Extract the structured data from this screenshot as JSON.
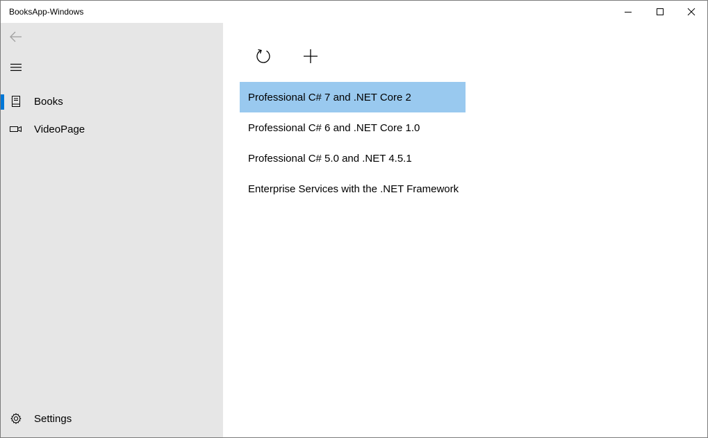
{
  "window": {
    "title": "BooksApp-Windows",
    "controls": {
      "minimize": "minimize-icon",
      "maximize": "maximize-icon",
      "close": "close-icon"
    }
  },
  "nav": {
    "back_icon": "back-arrow-icon",
    "menu_icon": "hamburger-icon",
    "items": [
      {
        "label": "Books",
        "icon": "book-icon",
        "selected": true
      },
      {
        "label": "VideoPage",
        "icon": "video-icon",
        "selected": false
      }
    ],
    "settings": {
      "label": "Settings",
      "icon": "gear-icon"
    },
    "accent_color": "#0078d7"
  },
  "commands": {
    "refresh_icon": "refresh-icon",
    "add_icon": "add-icon"
  },
  "books": [
    {
      "title": "Professional C# 7 and .NET Core 2",
      "selected": true
    },
    {
      "title": "Professional C# 6 and .NET Core 1.0",
      "selected": false
    },
    {
      "title": "Professional C# 5.0 and .NET 4.5.1",
      "selected": false
    },
    {
      "title": "Enterprise Services with the .NET Framework",
      "selected": false
    }
  ],
  "colors": {
    "nav_background": "#e6e6e6",
    "selection_background": "#99c9ef"
  }
}
